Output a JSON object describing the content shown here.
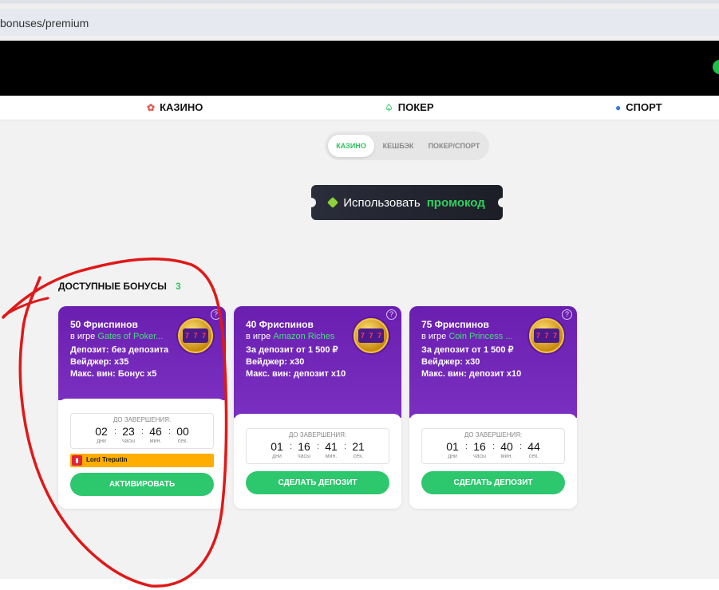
{
  "browser": {
    "url_fragment": "bonuses/premium"
  },
  "nav": {
    "items": [
      {
        "label": "КАЗИНО",
        "icon": "casino-icon"
      },
      {
        "label": "ПОКЕР",
        "icon": "poker-icon"
      },
      {
        "label": "СПОРТ",
        "icon": "sport-icon"
      }
    ]
  },
  "tabs": {
    "items": [
      "КАЗИНО",
      "КЕШБЭК",
      "ПОКЕР/СПОРТ"
    ],
    "active": "КАЗИНО"
  },
  "promo": {
    "text": "Использовать",
    "highlight": "промокод"
  },
  "section": {
    "title": "ДОСТУПНЫЕ БОНУСЫ",
    "count": "3"
  },
  "timer_label": "ДО ЗАВЕРШЕНИЯ:",
  "timer_units": [
    "дни",
    "часы",
    "мин.",
    "сек."
  ],
  "cards": [
    {
      "title": "50 Фриспинов",
      "game_prefix": "в игре",
      "game": "Gates of Poker...",
      "deposit": "Депозит: без депозита",
      "wager": "Вейджер: x35",
      "maxwin": "Макс. вин: Бонус x5",
      "timer": [
        "02",
        "23",
        "46",
        "00"
      ],
      "badge": "Lord Treputin",
      "button": "АКТИВИРОВАТЬ"
    },
    {
      "title": "40 Фриспинов",
      "game_prefix": "в игре",
      "game": "Amazon Riches",
      "deposit": "За депозит от 1 500 ₽",
      "wager": "Вейджер: x30",
      "maxwin": "Макс. вин: депозит x10",
      "timer": [
        "01",
        "16",
        "41",
        "21"
      ],
      "button": "СДЕЛАТЬ ДЕПОЗИТ"
    },
    {
      "title": "75 Фриспинов",
      "game_prefix": "в игре",
      "game": "Coin Princess ...",
      "deposit": "За депозит от 1 500 ₽",
      "wager": "Вейджер: x30",
      "maxwin": "Макс. вин: депозит x10",
      "timer": [
        "01",
        "16",
        "40",
        "44"
      ],
      "button": "СДЕЛАТЬ ДЕПОЗИТ"
    }
  ],
  "colors": {
    "accent": "#2dc76d",
    "card_purple": "#6a1fb0",
    "annotation": "#e01818"
  }
}
